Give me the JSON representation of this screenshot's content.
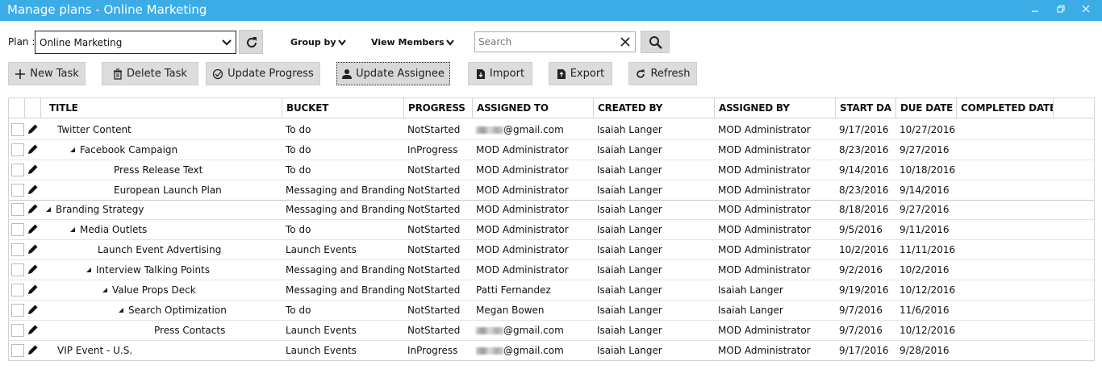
{
  "window": {
    "title": "Manage plans - Online Marketing"
  },
  "toolbar1": {
    "plan_label": "Plan :",
    "plan_value": "Online Marketing",
    "group_by": "Group by",
    "view_members": "View Members",
    "search_placeholder": "Search"
  },
  "toolbar2": {
    "new_task": "New Task",
    "delete_task": "Delete Task",
    "update_progress": "Update Progress",
    "update_assignee": "Update Assignee",
    "import": "Import",
    "export": "Export",
    "refresh": "Refresh"
  },
  "grid": {
    "columns": [
      "TITLE",
      "BUCKET",
      "PROGRESS",
      "ASSIGNED TO",
      "CREATED BY",
      "ASSIGNED BY",
      "START DA",
      "DUE DATE",
      "COMPLETED DATE"
    ],
    "rows": [
      {
        "title": "Twitter Content",
        "level": 0,
        "expander": false,
        "bucket": "To do",
        "progress": "NotStarted",
        "assigned_to": "@gmail.com",
        "assigned_redacted": true,
        "created_by": "Isaiah Langer",
        "assigned_by": "MOD Administrator",
        "start": "9/17/2016",
        "due": "10/27/2016",
        "completed": ""
      },
      {
        "title": "Facebook Campaign",
        "level": 1,
        "expander": true,
        "bucket": "To do",
        "progress": "InProgress",
        "assigned_to": "MOD Administrator",
        "assigned_redacted": false,
        "created_by": "Isaiah Langer",
        "assigned_by": "MOD Administrator",
        "start": "8/23/2016",
        "due": "9/27/2016",
        "completed": ""
      },
      {
        "title": "Press Release Text",
        "level": 3,
        "expander": false,
        "bucket": "To do",
        "progress": "NotStarted",
        "assigned_to": "MOD Administrator",
        "assigned_redacted": false,
        "created_by": "Isaiah Langer",
        "assigned_by": "MOD Administrator",
        "start": "9/14/2016",
        "due": "10/18/2016",
        "completed": ""
      },
      {
        "title": "European Launch Plan",
        "level": 3,
        "expander": false,
        "bucket": "Messaging and Branding",
        "progress": "NotStarted",
        "assigned_to": "MOD Administrator",
        "assigned_redacted": false,
        "created_by": "Isaiah Langer",
        "assigned_by": "MOD Administrator",
        "start": "8/23/2016",
        "due": "9/14/2016",
        "completed": ""
      },
      {
        "title": "Branding Strategy",
        "level": 0,
        "expander": true,
        "bucket": "Messaging and Branding",
        "progress": "NotStarted",
        "assigned_to": "MOD Administrator",
        "assigned_redacted": false,
        "created_by": "Isaiah Langer",
        "assigned_by": "MOD Administrator",
        "start": "8/18/2016",
        "due": "9/27/2016",
        "completed": ""
      },
      {
        "title": "Media Outlets",
        "level": 1,
        "expander": true,
        "bucket": "To do",
        "progress": "NotStarted",
        "assigned_to": "MOD Administrator",
        "assigned_redacted": false,
        "created_by": "Isaiah Langer",
        "assigned_by": "MOD Administrator",
        "start": "9/5/2016",
        "due": "9/11/2016",
        "completed": ""
      },
      {
        "title": "Launch Event Advertising",
        "level": 2,
        "expander": false,
        "bucket": "Launch Events",
        "progress": "NotStarted",
        "assigned_to": "MOD Administrator",
        "assigned_redacted": false,
        "created_by": "Isaiah Langer",
        "assigned_by": "MOD Administrator",
        "start": "10/2/2016",
        "due": "11/11/2016",
        "completed": ""
      },
      {
        "title": "Interview Talking Points",
        "level": 2,
        "expander": true,
        "bucket": "Messaging and Branding",
        "progress": "NotStarted",
        "assigned_to": "MOD Administrator",
        "assigned_redacted": false,
        "created_by": "Isaiah Langer",
        "assigned_by": "MOD Administrator",
        "start": "9/2/2016",
        "due": "10/2/2016",
        "completed": ""
      },
      {
        "title": "Value Props Deck",
        "level": 3,
        "expander": true,
        "bucket": "Messaging and Branding",
        "progress": "NotStarted",
        "assigned_to": "Patti Fernandez",
        "assigned_redacted": false,
        "created_by": "Isaiah Langer",
        "assigned_by": "Isaiah Langer",
        "start": "9/19/2016",
        "due": "10/12/2016",
        "completed": ""
      },
      {
        "title": "Search Optimization",
        "level": 4,
        "expander": true,
        "bucket": "To do",
        "progress": "NotStarted",
        "assigned_to": "Megan Bowen",
        "assigned_redacted": false,
        "created_by": "Isaiah Langer",
        "assigned_by": "Isaiah Langer",
        "start": "9/7/2016",
        "due": "11/6/2016",
        "completed": ""
      },
      {
        "title": "Press Contacts",
        "level": 5,
        "expander": false,
        "bucket": "Launch Events",
        "progress": "NotStarted",
        "assigned_to": "@gmail.com",
        "assigned_redacted": true,
        "created_by": "Isaiah Langer",
        "assigned_by": "MOD Administrator",
        "start": "9/7/2016",
        "due": "10/12/2016",
        "completed": ""
      },
      {
        "title": "VIP Event - U.S.",
        "level": 0,
        "expander": false,
        "bucket": "Launch Events",
        "progress": "InProgress",
        "assigned_to": "@gmail.com",
        "assigned_redacted": true,
        "created_by": "Isaiah Langer",
        "assigned_by": "MOD Administrator",
        "start": "9/17/2016",
        "due": "9/28/2016",
        "completed": ""
      }
    ]
  }
}
